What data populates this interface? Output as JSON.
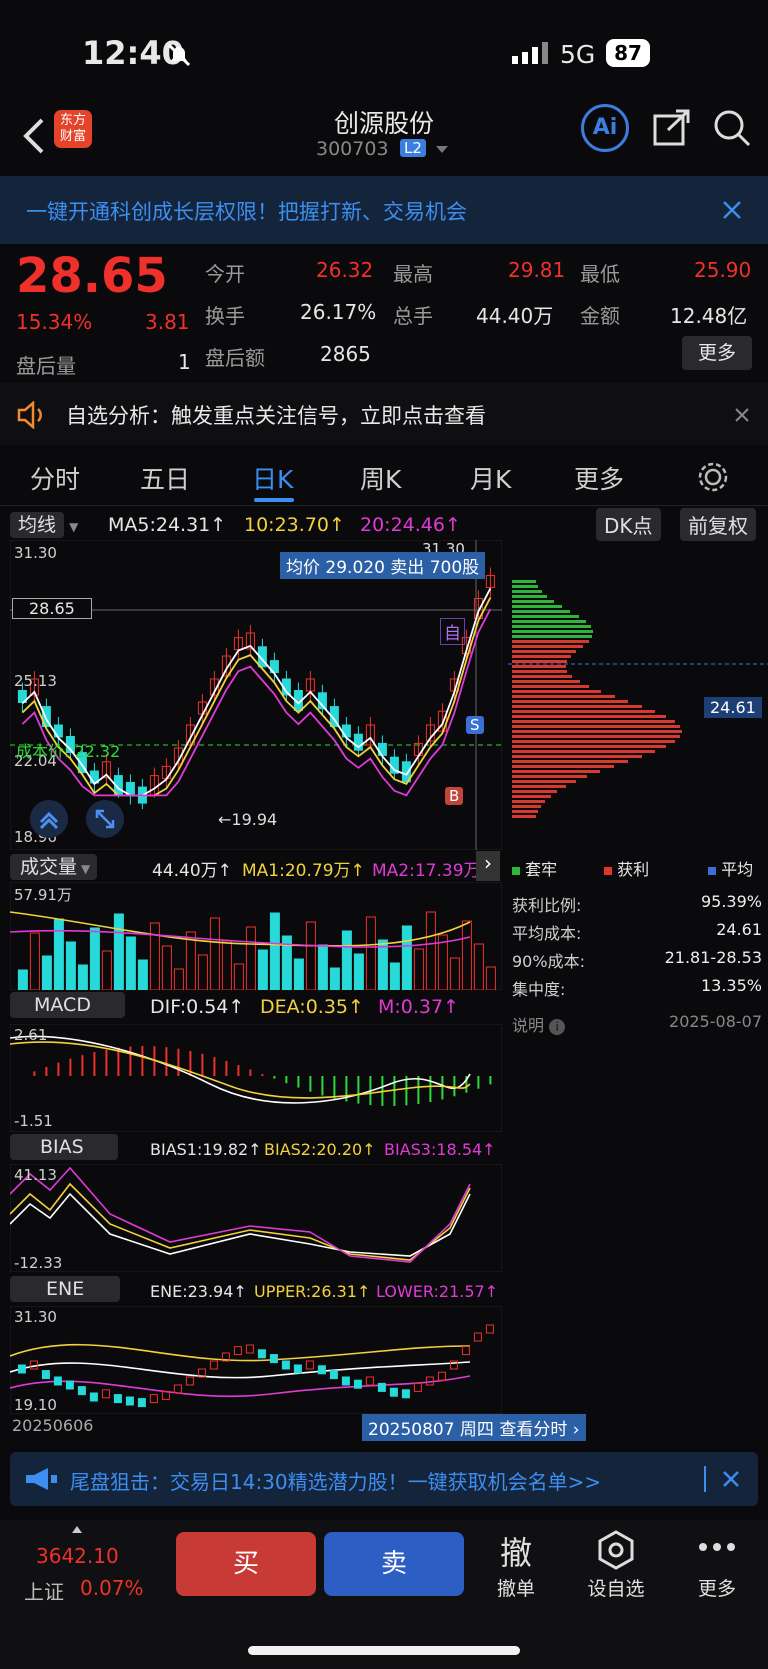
{
  "status_bar": {
    "time": "12:40",
    "network": "5G",
    "battery": "87"
  },
  "header": {
    "title": "创源股份",
    "code": "300703",
    "level_badge": "L2",
    "app_logo": "东方\n财富",
    "ai_label": "Ai"
  },
  "banner": {
    "text": "一键开通科创成长层权限！把握打新、交易机会"
  },
  "quote": {
    "price": "28.65",
    "change_pct": "15.34%",
    "change": "3.81",
    "after_hours_volume_label": "盘后量",
    "after_hours_volume": "1",
    "after_hours_amount_label": "盘后额",
    "after_hours_amount": "2865",
    "open_label": "今开",
    "open": "26.32",
    "high_label": "最高",
    "high": "29.81",
    "low_label": "最低",
    "low": "25.90",
    "turnover_label": "换手",
    "turnover": "26.17%",
    "total_hands_label": "总手",
    "total_hands": "44.40万",
    "amount_label": "金额",
    "amount": "12.48亿",
    "more_label": "更多"
  },
  "notice": {
    "text": "自选分析：触发重点关注信号，立即点击查看"
  },
  "tabs": [
    {
      "label": "分时"
    },
    {
      "label": "五日"
    },
    {
      "label": "日K",
      "active": true
    },
    {
      "label": "周K"
    },
    {
      "label": "月K"
    },
    {
      "label": "更多"
    }
  ],
  "main_chart": {
    "indicator_select": "均线",
    "ma5": "MA5:24.31↑",
    "ma10": "10:23.70↑",
    "ma20": "20:24.46↑",
    "dk_label": "DK点",
    "adjust_label": "前复权",
    "y_top": "31.30",
    "y_price": "28.65",
    "y_mid": "25.13",
    "y_low": "22.04",
    "y_bottom": "18.96",
    "top_label": "31.30",
    "low_marker": "←19.94",
    "tooltip": "均价 29.020 卖出 700股",
    "cost_line_label": "成本价: 22.32",
    "self_tag": "自",
    "b_tag": "B",
    "s_tag": "S",
    "profile_price": "24.61"
  },
  "chip_panel": {
    "legend": [
      {
        "label": "套牢",
        "color": "#2fb53a"
      },
      {
        "label": "获利",
        "color": "#e0352a"
      },
      {
        "label": "平均",
        "color": "#3a6fd8"
      }
    ],
    "rows": [
      {
        "label": "获利比例:",
        "value": "95.39%"
      },
      {
        "label": "平均成本:",
        "value": "24.61"
      },
      {
        "label": "90%成本:",
        "value": "21.81-28.53"
      },
      {
        "label": "集中度:",
        "value": "13.35%"
      }
    ],
    "note_label": "说明",
    "date": "2025-08-07"
  },
  "volume": {
    "select": "成交量",
    "value": "44.40万↑",
    "ma1": "MA1:20.79万↑",
    "ma2": "MA2:17.39万↑",
    "y_top": "57.91万"
  },
  "macd": {
    "select": "MACD",
    "dif": "DIF:0.54↑",
    "dea": "DEA:0.35↑",
    "m": "M:0.37↑",
    "y_top": "2.61",
    "y_bottom": "-1.51"
  },
  "bias": {
    "select": "BIAS",
    "b1": "BIAS1:19.82↑",
    "b2": "BIAS2:20.20↑",
    "b3": "BIAS3:18.54↑",
    "y_top": "41.13",
    "y_bottom": "-12.33"
  },
  "ene": {
    "select": "ENE",
    "ene": "ENE:23.94↑",
    "upper": "UPPER:26.31↑",
    "lower": "LOWER:21.57↑",
    "y_top": "31.30",
    "y_bottom": "19.10"
  },
  "date_axis": {
    "start": "20250606",
    "selected": "20250807 周四 查看分时"
  },
  "ad": {
    "text": "尾盘狙击：交易日14:30精选潜力股！一键获取机会名单>>"
  },
  "bottom_bar": {
    "index_value": "3642.10",
    "index_name": "上证",
    "index_change": "0.07%",
    "buy": "买",
    "sell": "卖",
    "cancel_glyph": "撤",
    "cancel_label": "撤单",
    "watch_label": "设自选",
    "more_label": "更多"
  },
  "colors": {
    "up": "#f0302a",
    "down": "#27d9d9",
    "accent": "#3b7ee0",
    "ma5": "#ffffff",
    "ma10": "#f2d23c",
    "ma20": "#e03ad6"
  }
}
